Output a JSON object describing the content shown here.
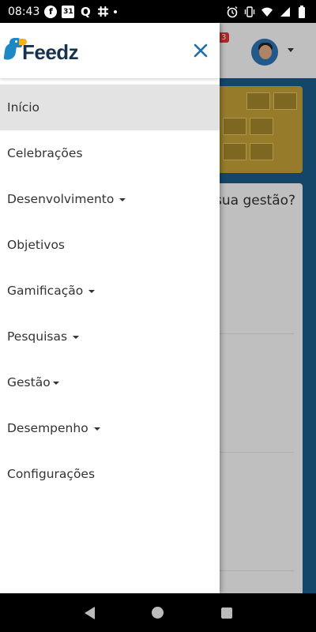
{
  "status_bar": {
    "time": "08:43",
    "notification_icons": [
      "facebook-icon",
      "calendar-icon",
      "quora-icon",
      "slack-icon",
      "more-dot-icon"
    ],
    "calendar_day": "31",
    "quora_glyph": "Q",
    "system_icons": [
      "alarm-icon",
      "vibrate-icon",
      "wifi-icon",
      "signal-icon",
      "battery-icon"
    ]
  },
  "background_page": {
    "notification_badge": "3",
    "card_text": "sua gestão?"
  },
  "drawer": {
    "logo_text": "Feedz",
    "close_icon": "close-icon",
    "items": [
      {
        "label": "Início",
        "active": true,
        "has_caret": false
      },
      {
        "label": "Celebrações",
        "active": false,
        "has_caret": false
      },
      {
        "label": "Desenvolvimento",
        "active": false,
        "has_caret": true
      },
      {
        "label": "Objetivos",
        "active": false,
        "has_caret": false
      },
      {
        "label": "Gamificação",
        "active": false,
        "has_caret": true
      },
      {
        "label": "Pesquisas",
        "active": false,
        "has_caret": true
      },
      {
        "label": "Gestão",
        "active": false,
        "has_caret": true
      },
      {
        "label": "Desempenho",
        "active": false,
        "has_caret": true
      },
      {
        "label": "Configurações",
        "active": false,
        "has_caret": false
      }
    ]
  },
  "nav_bar": {
    "buttons": [
      "back-icon",
      "home-icon",
      "recents-icon"
    ]
  },
  "colors": {
    "brand_blue": "#1e88c7",
    "brand_yellow": "#f6b21b",
    "logo_text": "#17324d",
    "active_item_bg": "#e3e3e3",
    "app_background": "#1b5e8e"
  }
}
